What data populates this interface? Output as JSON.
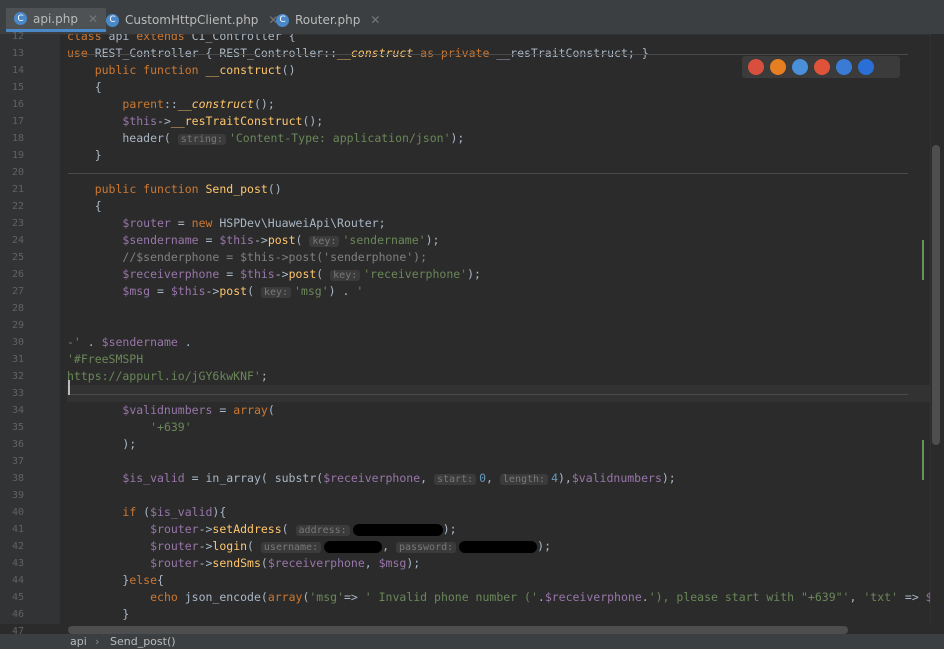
{
  "tabs": [
    {
      "label": "api.php",
      "active": true
    },
    {
      "label": "CustomHttpClient.php",
      "active": false
    },
    {
      "label": "Router.php",
      "active": false
    }
  ],
  "lines": [
    {
      "n": "12",
      "html": "<span class='kw'>class</span> api <span class='kw'>extends</span> CI_Controller {"
    },
    {
      "n": "13",
      "html": "<span class='kw'>use</span> REST_Controller { REST_Controller::<span class='fn it'>__construct</span> <span class='kw'>as private</span> __resTraitConstruct; }"
    },
    {
      "n": "14",
      "html": "    <span class='kw'>public function</span> <span class='fn'>__construct</span>()"
    },
    {
      "n": "15",
      "html": "    {"
    },
    {
      "n": "16",
      "html": "        <span class='kw'>parent</span>::<span class='fn it'>__construct</span>();"
    },
    {
      "n": "17",
      "html": "        <span class='va'>$this</span>-><span class='fn'>__resTraitConstruct</span>();"
    },
    {
      "n": "18",
      "html": "        header( <span class='hint'>string:</span><span class='st'>'Content-Type: application/json'</span>);"
    },
    {
      "n": "19",
      "html": "    }"
    },
    {
      "n": "20",
      "html": ""
    },
    {
      "n": "21",
      "html": "    <span class='kw'>public function</span> <span class='fn'>Send_post</span>()"
    },
    {
      "n": "22",
      "html": "    {"
    },
    {
      "n": "23",
      "html": "        <span class='va'>$router</span> = <span class='kw'>new</span> HSPDev\\HuaweiApi\\Router;"
    },
    {
      "n": "24",
      "html": "        <span class='va'>$sendername</span> = <span class='va'>$this</span>-><span class='fn'>post</span>( <span class='hint'>key:</span><span class='st'>'sendername'</span>);"
    },
    {
      "n": "25",
      "html": "        <span style='color:#808080'>//$senderphone = $this->post('senderphone');</span>"
    },
    {
      "n": "26",
      "html": "        <span class='va'>$receiverphone</span> = <span class='va'>$this</span>-><span class='fn'>post</span>( <span class='hint'>key:</span><span class='st'>'receiverphone'</span>);"
    },
    {
      "n": "27",
      "html": "        <span class='va'>$msg</span> = <span class='va'>$this</span>-><span class='fn'>post</span>( <span class='hint'>key:</span><span class='st'>'msg'</span>) . <span class='st'>'</span>"
    },
    {
      "n": "28",
      "html": ""
    },
    {
      "n": "29",
      "html": ""
    },
    {
      "n": "30",
      "html": "<span class='st'>-'</span> . <span class='va'>$sendername</span> ."
    },
    {
      "n": "31",
      "html": "<span class='st'>'#FreeSMSPH</span>"
    },
    {
      "n": "32",
      "html": "<span class='st'>https://appurl.io/jGY6kwKNF'</span>;"
    },
    {
      "n": "33",
      "html": ""
    },
    {
      "n": "34",
      "html": "        <span class='va'>$validnumbers</span> = <span class='kw'>array</span>("
    },
    {
      "n": "35",
      "html": "            <span class='st'>'+639'</span>"
    },
    {
      "n": "36",
      "html": "        );"
    },
    {
      "n": "37",
      "html": ""
    },
    {
      "n": "38",
      "html": "        <span class='va'>$is_valid</span> = in_array( substr(<span class='va'>$receiverphone</span>, <span class='hint'>start:</span><span style='color:#6897bb'>0</span>, <span class='hint'>length:</span><span style='color:#6897bb'>4</span>),<span class='va'>$validnumbers</span>);"
    },
    {
      "n": "39",
      "html": ""
    },
    {
      "n": "40",
      "html": "        <span class='kw'>if</span> (<span class='va'>$is_valid</span>){"
    },
    {
      "n": "41",
      "html": "            <span class='va'>$router</span>-><span class='fn'>setAddress</span>( <span class='hint'>address:</span><span class='redact' style='width:90px'></span>);"
    },
    {
      "n": "42",
      "html": "            <span class='va'>$router</span>-><span class='fn'>login</span>( <span class='hint'>username:</span><span class='redact' style='width:58px'></span>, <span class='hint'>password:</span><span class='redact' style='width:78px'></span>);"
    },
    {
      "n": "43",
      "html": "            <span class='va'>$router</span>-><span class='fn'>sendSms</span>(<span class='va'>$receiverphone</span>, <span class='va'>$msg</span>);"
    },
    {
      "n": "44",
      "html": "        }<span class='kw'>else</span>{"
    },
    {
      "n": "45",
      "html": "            <span class='kw'>echo</span> json_encode(<span class='kw'>array</span>(<span class='st'>'msg'</span>=> <span class='st'>' Invalid phone number ('</span>.<span class='va'>$receiverphone</span>.<span class='st'>'), please start with \"+639\"'</span>, <span class='st'>'txt'</span> => <span class='va'>$</span>"
    },
    {
      "n": "46",
      "html": "        }"
    },
    {
      "n": "47",
      "html": "    }"
    }
  ],
  "statusbar": {
    "crumb1": "api",
    "crumb2": "Send_post()"
  }
}
